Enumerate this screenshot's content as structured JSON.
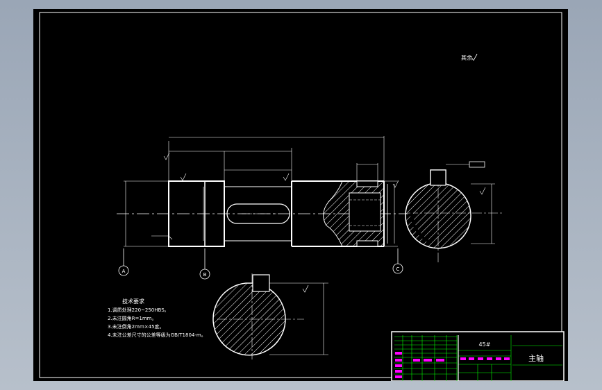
{
  "drawing": {
    "roughness_note": "其余",
    "tech_req": {
      "title": "技术要求",
      "items": [
        "1.调质处理220~250HBS。",
        "2.未注圆角R=1mm。",
        "3.未注倒角2mm×45度。",
        "4.未注公差尺寸的公差等级为GB/T1804-m。"
      ]
    },
    "section_labels": [
      "A",
      "B",
      "C"
    ],
    "title_block": {
      "material": "45#",
      "part_name": "主轴"
    }
  },
  "colors": {
    "background": "#000000",
    "outline": "#ffffff",
    "dimension": "#ffffff",
    "hatch": "#ffffff",
    "title_text": "#ffffff",
    "title_lines": "#00ff00",
    "title_labels": "#ff00ff",
    "page_frame": "#a3adba"
  }
}
